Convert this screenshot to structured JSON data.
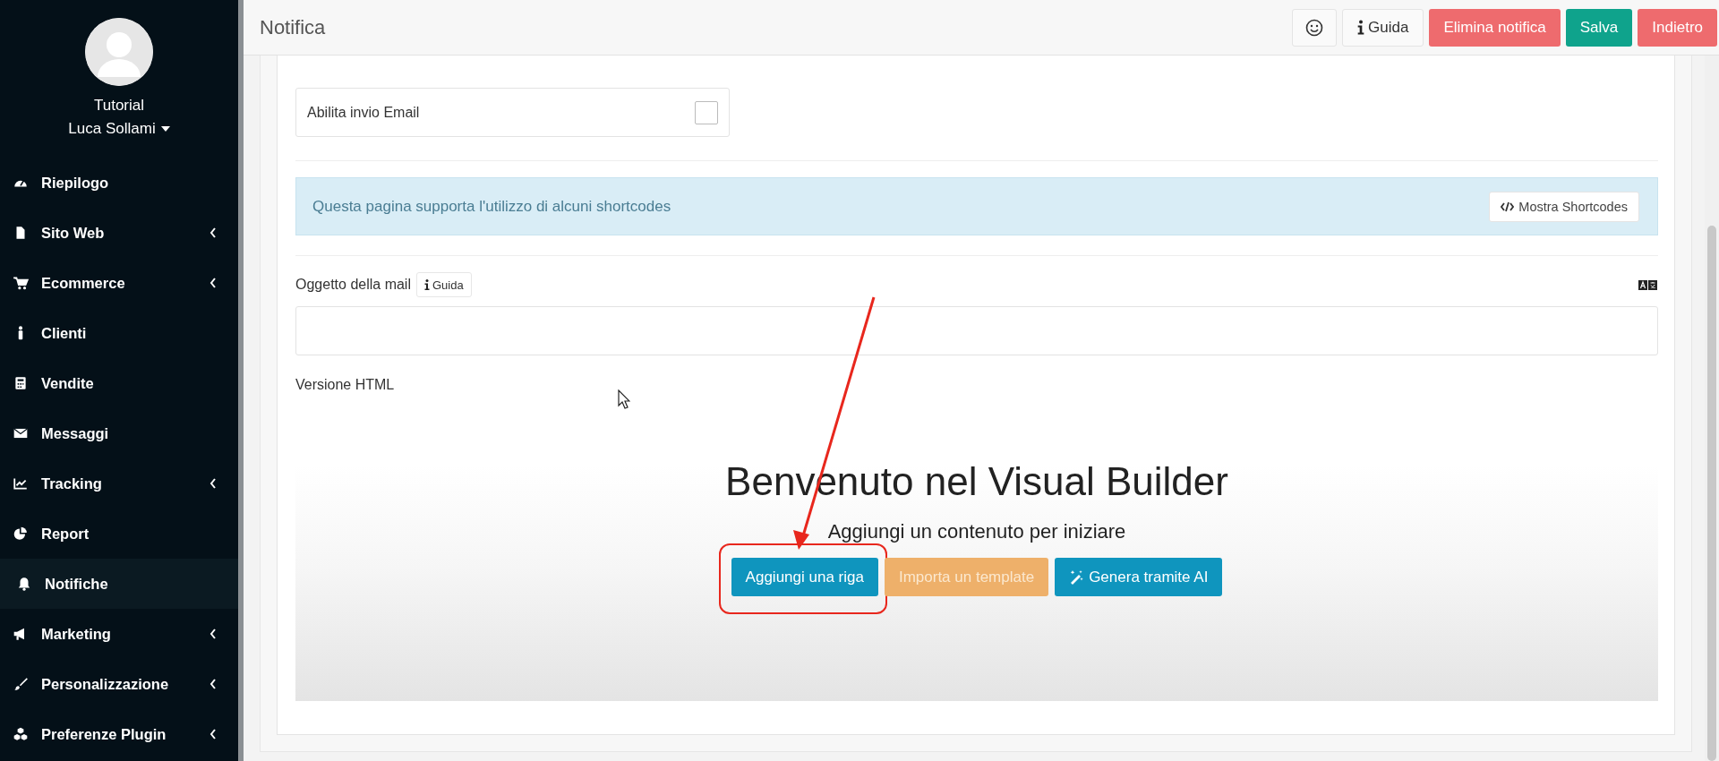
{
  "sidebar": {
    "user": {
      "line_1": "Tutorial",
      "line_2": "Luca Sollami"
    },
    "items": [
      {
        "label": "Riepilogo",
        "submenu": false,
        "selected": false
      },
      {
        "label": "Sito Web",
        "submenu": true,
        "selected": false
      },
      {
        "label": "Ecommerce",
        "submenu": true,
        "selected": false
      },
      {
        "label": "Clienti",
        "submenu": false,
        "selected": false
      },
      {
        "label": "Vendite",
        "submenu": false,
        "selected": false
      },
      {
        "label": "Messaggi",
        "submenu": false,
        "selected": false
      },
      {
        "label": "Tracking",
        "submenu": true,
        "selected": false
      },
      {
        "label": "Report",
        "submenu": false,
        "selected": false
      },
      {
        "label": "Notifiche",
        "submenu": false,
        "selected": true
      },
      {
        "label": "Marketing",
        "submenu": true,
        "selected": false
      },
      {
        "label": "Personalizzazione",
        "submenu": true,
        "selected": false
      },
      {
        "label": "Preferenze Plugin",
        "submenu": true,
        "selected": false
      }
    ]
  },
  "header": {
    "title": "Notifica",
    "buttons": [
      {
        "kind": "emoji"
      },
      {
        "kind": "help",
        "label": "Guida"
      },
      {
        "kind": "danger",
        "label": "Elimina notifica"
      },
      {
        "kind": "success",
        "label": "Salva"
      },
      {
        "kind": "danger",
        "label": "Indietro"
      }
    ]
  },
  "form": {
    "email_toggle": {
      "label": "Abilita invio Email",
      "checked": false
    },
    "info": {
      "text": "Questa pagina supporta l'utilizzo di alcuni shortcodes",
      "button": "Mostra Shortcodes"
    },
    "subject": {
      "label": "Oggetto della mail",
      "help": "Guida"
    },
    "html_label": "Versione HTML"
  },
  "builder": {
    "title": "Benvenuto nel Visual Builder",
    "subtitle": "Aggiungi un contenuto per iniziare",
    "buttons": [
      {
        "kind": "primary",
        "label": "Aggiungi una riga",
        "highlighted": true
      },
      {
        "kind": "warning",
        "label": "Importa un template",
        "highlighted": false
      },
      {
        "kind": "ai",
        "label": "Genera tramite AI",
        "highlighted": false
      }
    ]
  }
}
